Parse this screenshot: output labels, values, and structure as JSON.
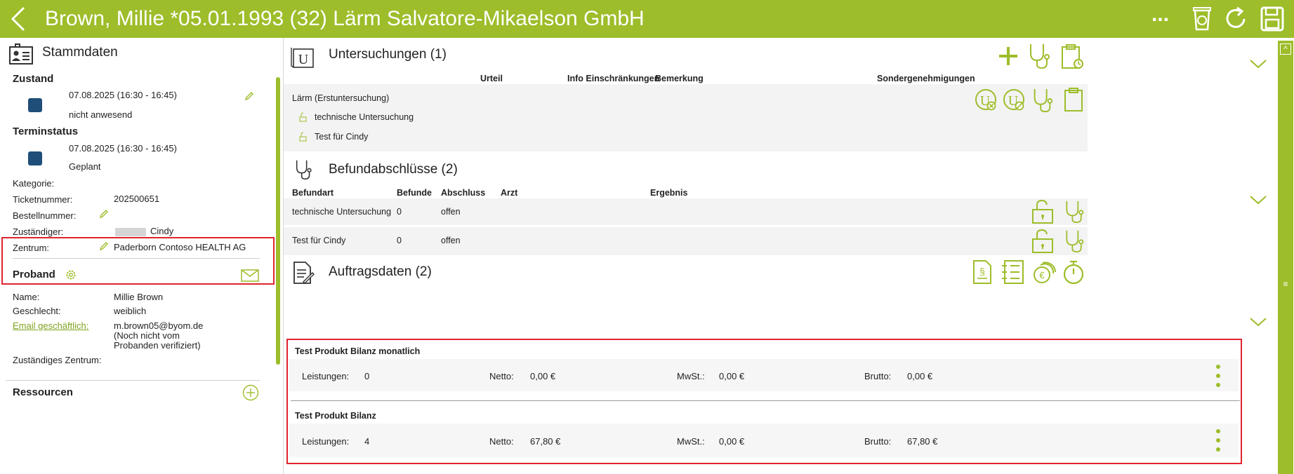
{
  "header": {
    "title": "Brown, Millie *05.01.1993 (32) Lärm Salvatore-Mikaelson GmbH",
    "more_label": "..."
  },
  "left": {
    "section_title": "Stammdaten",
    "zustand": {
      "heading": "Zustand",
      "date": "07.08.2025 (16:30 - 16:45)",
      "status": "nicht anwesend"
    },
    "terminstatus": {
      "heading": "Terminstatus",
      "date": "07.08.2025 (16:30 - 16:45)",
      "status": "Geplant"
    },
    "fields": {
      "kategorie_label": "Kategorie:",
      "kategorie_value": "",
      "ticket_label": "Ticketnummer:",
      "ticket_value": "202500651",
      "bestell_label": "Bestellnummer:",
      "zustaendiger_label": "Zuständiger:",
      "zustaendiger_value": "Cindy",
      "zentrum_label": "Zentrum:",
      "zentrum_value": "Paderborn Contoso HEALTH AG"
    },
    "proband": {
      "heading": "Proband",
      "name_label": "Name:",
      "name_value": "Millie Brown",
      "geschlecht_label": "Geschlecht:",
      "geschlecht_value": "weiblich",
      "email_label": "Email geschäftlich:",
      "email_value": "m.brown05@byom.de",
      "email_note_1": "(Noch nicht vom",
      "email_note_2": "Probanden verifiziert)",
      "zentrum_label": "Zuständiges Zentrum:",
      "zentrum_value": ""
    },
    "ressourcen_heading": "Ressourcen"
  },
  "untersuchungen": {
    "title": "Untersuchungen (1)",
    "columns": [
      "Urteil",
      "Info Einschränkungen",
      "Bemerkung",
      "Sondergenehmigungen"
    ],
    "exam": "Lärm (Erstuntersuchung)",
    "subitems": [
      "technische Untersuchung",
      "Test für Cindy"
    ]
  },
  "befund": {
    "title": "Befundabschlüsse (2)",
    "columns": [
      "Befundart",
      "Befunde",
      "Abschluss",
      "Arzt",
      "Ergebnis"
    ],
    "rows": [
      {
        "befundart": "technische Untersuchung",
        "befunde": "0",
        "abschluss": "offen",
        "arzt": "",
        "ergebnis": ""
      },
      {
        "befundart": "Test für Cindy",
        "befunde": "0",
        "abschluss": "offen",
        "arzt": "",
        "ergebnis": ""
      }
    ]
  },
  "auftrag": {
    "title": "Auftragsdaten (2)",
    "products": [
      {
        "name": "Test Produkt Bilanz monatlich",
        "leistungen_label": "Leistungen:",
        "leistungen": "0",
        "netto_label": "Netto:",
        "netto": "0,00 €",
        "mwst_label": "MwSt.:",
        "mwst": "0,00 €",
        "brutto_label": "Brutto:",
        "brutto": "0,00 €"
      },
      {
        "name": "Test Produkt Bilanz",
        "leistungen_label": "Leistungen:",
        "leistungen": "4",
        "netto_label": "Netto:",
        "netto": "67,80 €",
        "mwst_label": "MwSt.:",
        "mwst": "0,00 €",
        "brutto_label": "Brutto:",
        "brutto": "67,80 €"
      }
    ]
  },
  "colors": {
    "accent": "#9dbd2a",
    "status_square": "#1f4e79",
    "highlight": "#e0242e"
  },
  "scrollbar": {
    "up": "^",
    "grip": "≡"
  }
}
